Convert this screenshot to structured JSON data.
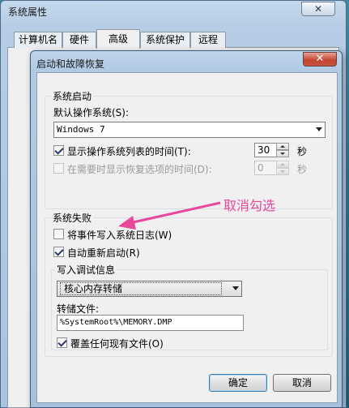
{
  "back_window": {
    "title": "系统属性",
    "close_glyph": "✕",
    "tabs": [
      "计算机名",
      "硬件",
      "高级",
      "系统保护",
      "远程"
    ]
  },
  "dialog": {
    "title": "启动和故障恢复",
    "close_glyph": "✕",
    "startup": {
      "group_label": "系统启动",
      "default_os_label": "默认操作系统(S):",
      "default_os_value": "Windows 7",
      "show_os_list": {
        "label": "显示操作系统列表的时间(T):",
        "checked": true,
        "value": "30",
        "unit": "秒"
      },
      "show_recovery": {
        "label": "在需要时显示恢复选项的时间(D):",
        "checked": false,
        "value": "0",
        "unit": "秒"
      }
    },
    "failure": {
      "group_label": "系统失败",
      "write_event": {
        "label": "将事件写入系统日志(W)",
        "checked": false
      },
      "auto_restart": {
        "label": "自动重新启动(R)",
        "checked": true
      },
      "debug_group_label": "写入调试信息",
      "debug_type": "核心内存转储",
      "dump_file_label": "转储文件:",
      "dump_file_value": "%SystemRoot%\\MEMORY.DMP",
      "overwrite": {
        "label": "覆盖任何现有文件(O)",
        "checked": true
      }
    },
    "buttons": {
      "ok": "确定",
      "cancel": "取消"
    }
  },
  "annotation": {
    "text": "取消勾选",
    "color": "#e8479b"
  }
}
